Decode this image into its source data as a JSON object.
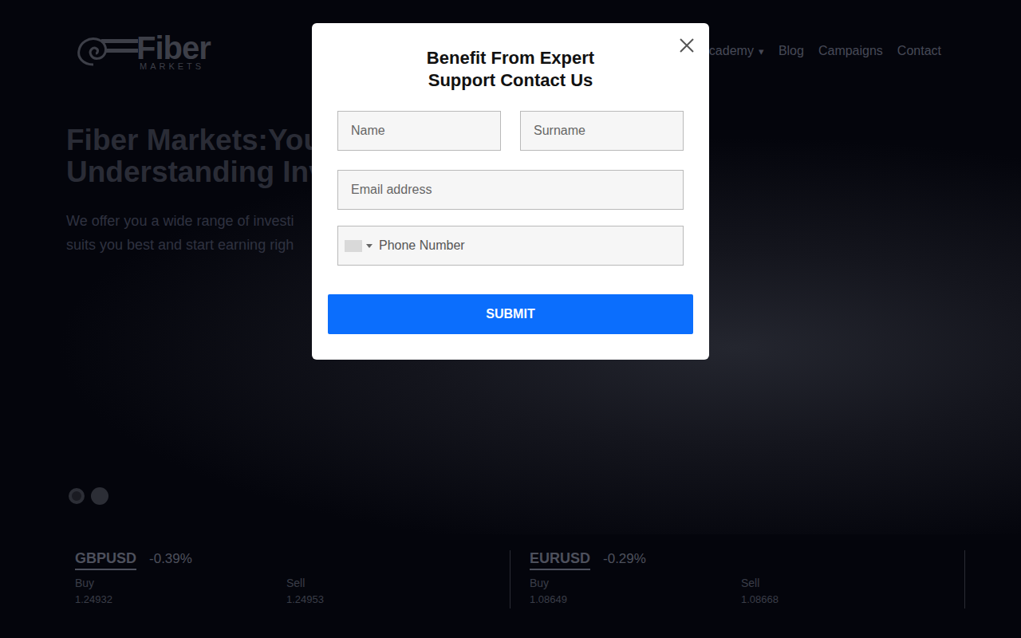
{
  "logo": {
    "name": "Fiber",
    "sub": "MARKETS"
  },
  "nav": [
    {
      "label": "Academy",
      "dropdown": true
    },
    {
      "label": "Blog",
      "dropdown": false
    },
    {
      "label": "Campaigns",
      "dropdown": false
    },
    {
      "label": "Contact",
      "dropdown": false
    }
  ],
  "nav_dropdown_icon": "▾",
  "hero": {
    "title": [
      "Fiber Markets:You",
      "Understanding Inv"
    ],
    "text": [
      "We offer you a wide range of investi",
      "suits you best and start earning righ"
    ]
  },
  "slider_dots": [
    {
      "selected": true
    },
    {
      "selected": false
    }
  ],
  "tickers": [
    {
      "symbol": "GBPUSD",
      "change": "-0.39%",
      "buy_label": "Buy",
      "buy": "1.24932",
      "sell_label": "Sell",
      "sell": "1.24953"
    },
    {
      "symbol": "EURUSD",
      "change": "-0.29%",
      "buy_label": "Buy",
      "buy": "1.08649",
      "sell_label": "Sell",
      "sell": "1.08668"
    }
  ],
  "modal": {
    "title": [
      "Benefit From Expert",
      "Support Contact Us"
    ],
    "fields": [
      {
        "kind": "text",
        "placeholder": "Name"
      },
      {
        "kind": "text",
        "placeholder": "Surname"
      },
      {
        "kind": "wide",
        "placeholder": "Email address"
      },
      {
        "kind": "phone",
        "placeholder": "Phone Number"
      }
    ],
    "submit": "SUBMIT"
  }
}
